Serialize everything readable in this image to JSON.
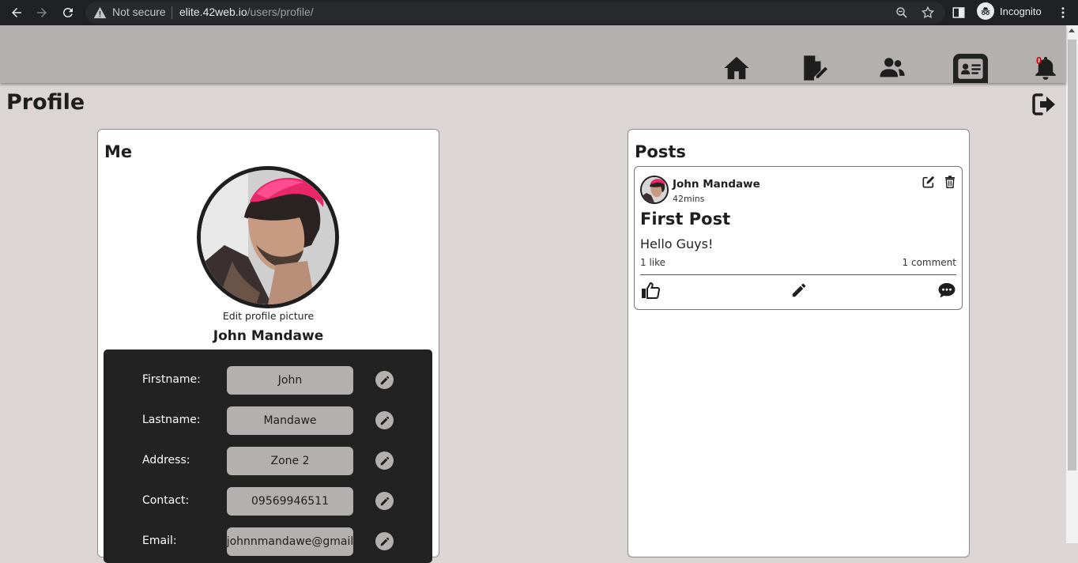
{
  "browser": {
    "security_label": "Not secure",
    "url_host": "elite.42web.io",
    "url_path": "/users/profile/",
    "incognito_label": "Incognito"
  },
  "nav": {
    "items": [
      "home-icon",
      "post-edit-icon",
      "users-icon",
      "profile-card-icon",
      "bell-icon"
    ],
    "active": "profile-card-icon",
    "notification_count": "0"
  },
  "page": {
    "title": "Profile"
  },
  "me": {
    "title": "Me",
    "edit_picture_label": "Edit profile picture",
    "full_name": "John Mandawe",
    "fields": [
      {
        "label": "Firstname:",
        "value": "John"
      },
      {
        "label": "Lastname:",
        "value": "Mandawe"
      },
      {
        "label": "Address:",
        "value": "Zone 2"
      },
      {
        "label": "Contact:",
        "value": "09569946511"
      },
      {
        "label": "Email:",
        "value": "johnnmandawe@gmail"
      }
    ]
  },
  "posts": {
    "title": "Posts",
    "items": [
      {
        "author": "John Mandawe",
        "time": "42mins",
        "title": "First Post",
        "body": "Hello Guys!",
        "likes": "1 like",
        "comments": "1 comment"
      }
    ]
  },
  "colors": {
    "navbar": "#b5b0b0",
    "page_bg": "#dcd5d5",
    "dark_panel": "#222222",
    "notification": "#d00000"
  }
}
